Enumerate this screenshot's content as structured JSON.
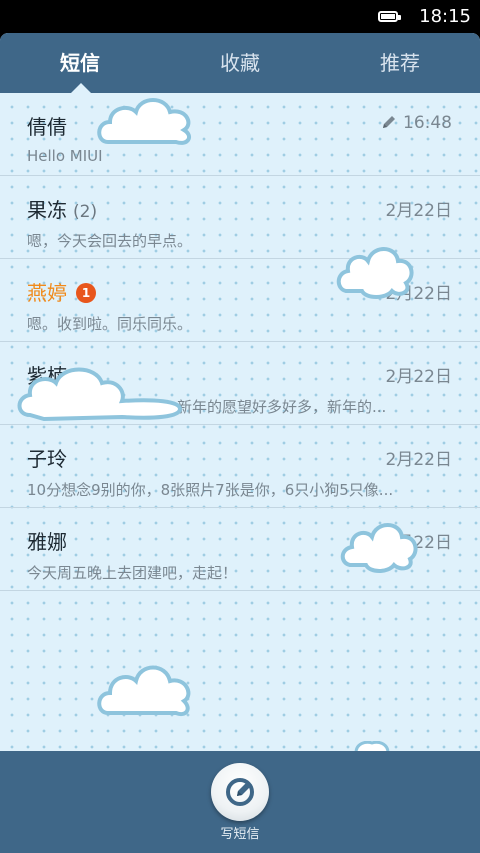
{
  "status_bar": {
    "time": "18:15",
    "battery_icon": "battery-full-icon"
  },
  "tabs": [
    {
      "label": "短信",
      "active": true
    },
    {
      "label": "收藏",
      "active": false
    },
    {
      "label": "推荐",
      "active": false
    }
  ],
  "conversations": [
    {
      "name": "倩倩",
      "count": "",
      "unread_badge": "",
      "date": "16:48",
      "draft": true,
      "preview": "Hello MIUI"
    },
    {
      "name": "果冻",
      "count": "(2)",
      "unread_badge": "",
      "date": "2月22日",
      "draft": false,
      "preview": "嗯，今天会回去的早点。"
    },
    {
      "name": "燕婷",
      "count": "",
      "unread_badge": "1",
      "date": "2月22日",
      "draft": false,
      "preview": "嗯。收到啦。同乐同乐。"
    },
    {
      "name": "紫楠",
      "count": "",
      "unread_badge": "",
      "date": "2月22日",
      "draft": false,
      "preview": "新年的祝福数不胜数，新年的愿望好多好多，新年的..."
    },
    {
      "name": "子玲",
      "count": "",
      "unread_badge": "",
      "date": "2月22日",
      "draft": false,
      "preview": "10分想念9别的你，8张照片7张是你，6只小狗5只像..."
    },
    {
      "name": "雅娜",
      "count": "",
      "unread_badge": "",
      "date": "2月22日",
      "draft": false,
      "preview": "今天周五晚上去团建吧，走起！"
    }
  ],
  "bottom_bar": {
    "compose_label": "写短信",
    "compose_icon": "compose-icon"
  },
  "colors": {
    "header": "#3f6788",
    "list_bg": "#dff1fb",
    "unread_name": "#f08a1b",
    "badge": "#e8561c"
  }
}
